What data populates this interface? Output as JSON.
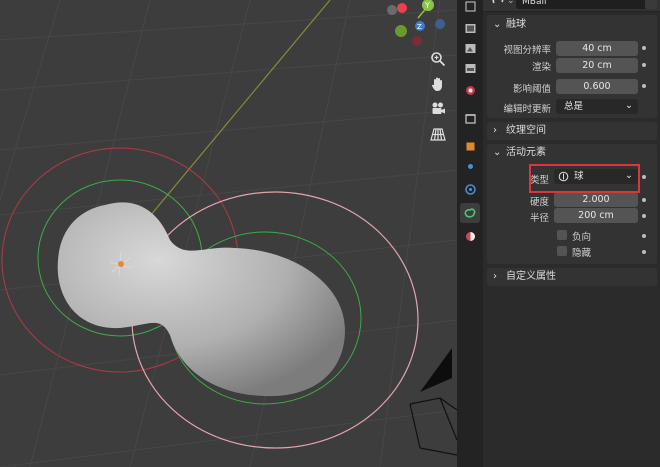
{
  "properties": {
    "header_value": "MBall",
    "metaball_section": {
      "title": "融球",
      "rows": [
        {
          "label": "视图分辨率",
          "value": "40 cm"
        },
        {
          "label": "渲染",
          "value": "20 cm"
        },
        {
          "label": "影响阈值",
          "value": "0.600"
        }
      ],
      "update_label": "编辑时更新",
      "update_value": "总是"
    },
    "texture_space": {
      "title": "纹理空间"
    },
    "active_element": {
      "title": "活动元素",
      "type_label": "类型",
      "type_value": "球",
      "stiffness_label": "硬度",
      "stiffness_value": "2.000",
      "radius_label": "半径",
      "radius_value": "200 cm",
      "negative_label": "负向",
      "hide_label": "隐藏"
    },
    "custom_props": {
      "title": "自定义属性"
    }
  },
  "gizmo": {
    "y_label": "Y",
    "z_label": "Z"
  },
  "colors": {
    "highlight": "#e0343d",
    "axis_y": "#8bc34a",
    "axis_x": "#e8424d",
    "axis_z": "#3e7bd6"
  }
}
